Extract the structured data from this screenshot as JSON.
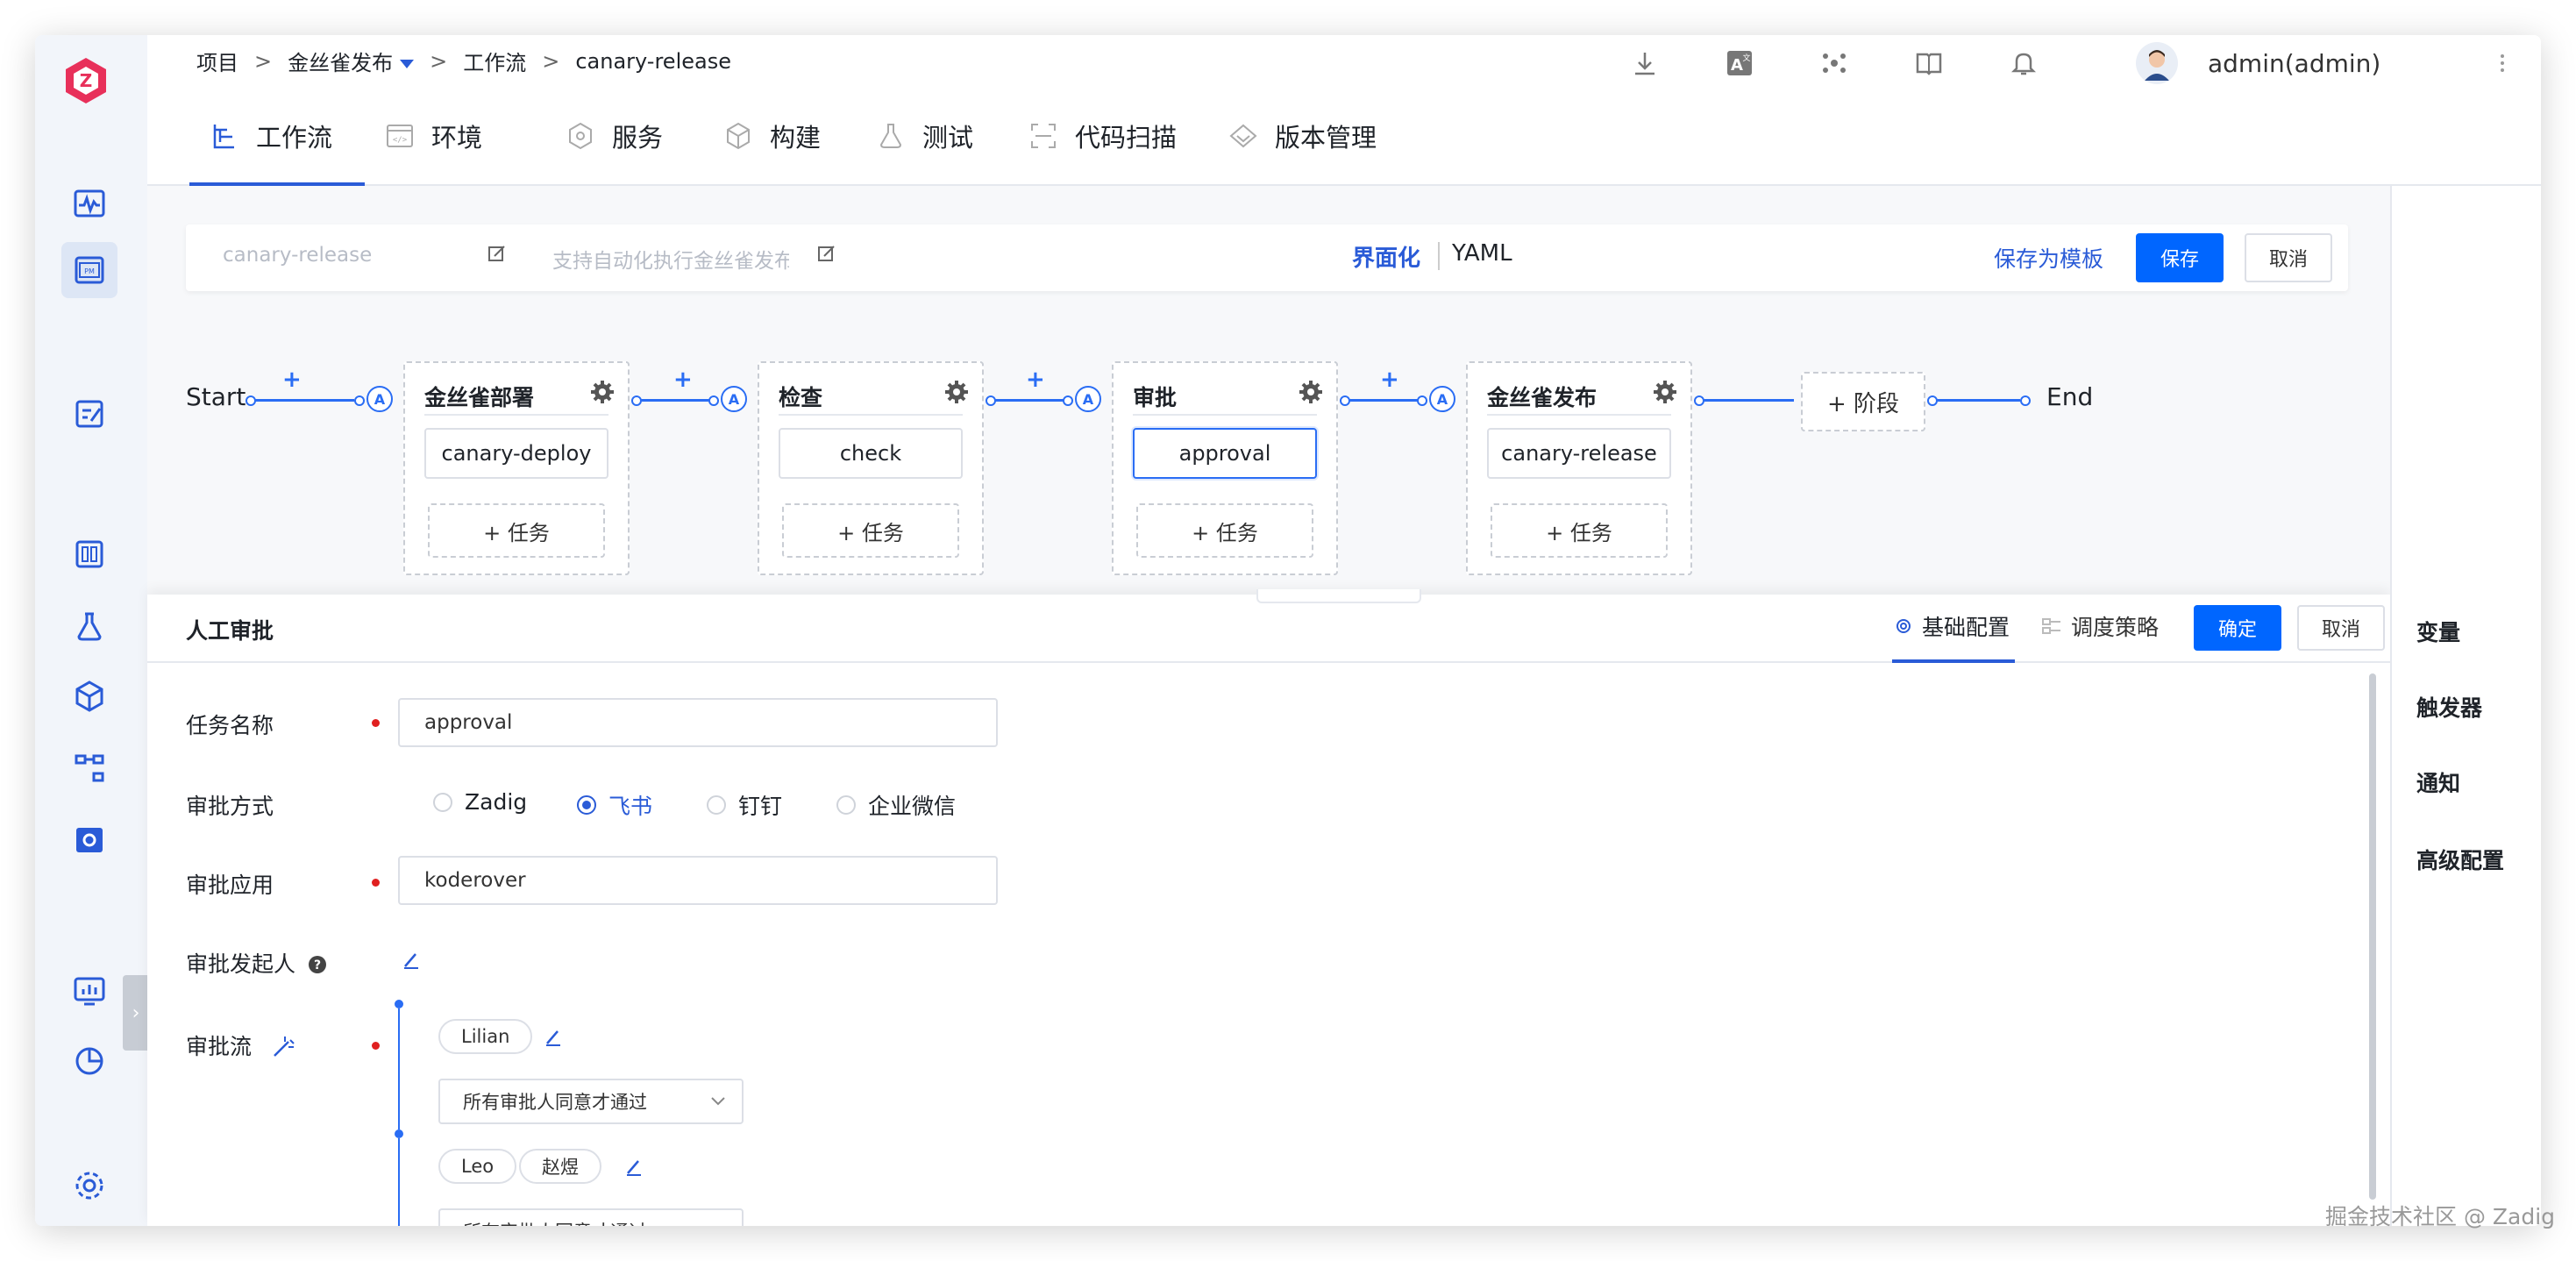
{
  "header": {
    "breadcrumb": [
      "项目",
      "金丝雀发布",
      "工作流",
      "canary-release"
    ],
    "separator": ">",
    "username": "admin(admin)"
  },
  "module_tabs": [
    {
      "label": "工作流",
      "icon": "workflow-icon"
    },
    {
      "label": "环境",
      "icon": "environment-icon"
    },
    {
      "label": "服务",
      "icon": "service-icon"
    },
    {
      "label": "构建",
      "icon": "build-icon"
    },
    {
      "label": "测试",
      "icon": "test-icon"
    },
    {
      "label": "代码扫描",
      "icon": "code-scan-icon"
    },
    {
      "label": "版本管理",
      "icon": "version-icon"
    }
  ],
  "editor_bar": {
    "name_placeholder": "canary-release",
    "desc_placeholder": "支持自动化执行金丝雀发布",
    "mode_ui": "界面化",
    "mode_yaml": "YAML",
    "save_template": "保存为模板",
    "save": "保存",
    "cancel": "取消"
  },
  "pipeline": {
    "start": "Start",
    "end": "End",
    "plus": "+",
    "auto_mark": "A",
    "add_stage": "+ 阶段",
    "add_task": "+ 任务",
    "stages": [
      {
        "name": "金丝雀部署",
        "job": "canary-deploy"
      },
      {
        "name": "检查",
        "job": "check"
      },
      {
        "name": "审批",
        "job": "approval"
      },
      {
        "name": "金丝雀发布",
        "job": "canary-release"
      }
    ]
  },
  "detail": {
    "title": "人工审批",
    "tab_basic": "基础配置",
    "tab_schedule": "调度策略",
    "confirm": "确定",
    "cancel": "取消",
    "task_name_label": "任务名称",
    "task_name_value": "approval",
    "method_label": "审批方式",
    "methods": [
      "Zadig",
      "飞书",
      "钉钉",
      "企业微信"
    ],
    "method_selected": "飞书",
    "app_label": "审批应用",
    "app_value": "koderover",
    "initiator_label": "审批发起人",
    "flow_label": "审批流",
    "flow_nodes": [
      {
        "approvers": [
          "Lilian"
        ],
        "rule": "所有审批人同意才通过"
      },
      {
        "approvers": [
          "Leo",
          "赵煜"
        ],
        "rule": "所有审批人同意才通过"
      }
    ]
  },
  "right_panel": [
    "变量",
    "触发器",
    "通知",
    "高级配置"
  ],
  "watermark": "掘金技术社区 @ Zadig",
  "colors": {
    "primary": "#0066ff",
    "link": "#2a5bd7",
    "required": "#e02020"
  }
}
